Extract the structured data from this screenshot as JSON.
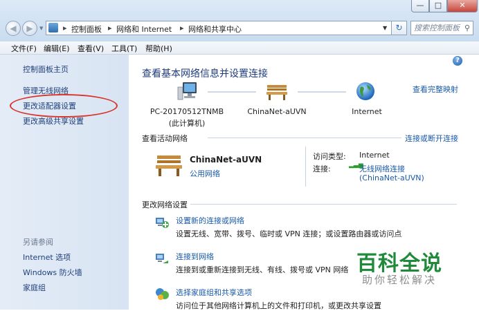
{
  "window": {
    "min_label": "—",
    "max_label": "□",
    "close_label": "✕"
  },
  "address": {
    "crumbs": [
      "控制面板",
      "网络和 Internet",
      "网络和共享中心"
    ],
    "search_placeholder": "搜索控制面板"
  },
  "menu": [
    "文件(F)",
    "编辑(E)",
    "查看(V)",
    "工具(T)",
    "帮助(H)"
  ],
  "left": {
    "home": "控制面板主页",
    "links": [
      "管理无线网络",
      "更改适配器设置",
      "更改高级共享设置"
    ],
    "see_also_title": "另请参阅",
    "see_also": [
      "Internet 选项",
      "Windows 防火墙",
      "家庭组"
    ]
  },
  "main": {
    "title": "查看基本网络信息并设置连接",
    "view_full_map": "查看完整映射",
    "nodes": [
      {
        "name": "PC-20170512TNMB",
        "sub": "(此计算机)",
        "icon": "computer-icon"
      },
      {
        "name": "ChinaNet-aUVN",
        "icon": "bench-icon"
      },
      {
        "name": "Internet",
        "icon": "globe-icon"
      }
    ],
    "active_title": "查看活动网络",
    "connect_disconnect": "连接或断开连接",
    "active": {
      "network_name": "ChinaNet-aUVN",
      "network_type": "公用网络",
      "access_label": "访问类型:",
      "access_value": "Internet",
      "conn_label": "连接:",
      "conn_value": "无线网络连接",
      "conn_value2": "(ChinaNet-aUVN)"
    },
    "change_title": "更改网络设置",
    "tasks": [
      {
        "title": "设置新的连接或网络",
        "desc": "设置无线、宽带、拨号、临时或 VPN 连接；或设置路由器或访问点"
      },
      {
        "title": "连接到网络",
        "desc": "连接到或重新连接到无线、有线、拨号或 VPN 网络"
      },
      {
        "title": "选择家庭组和共享选项",
        "desc": "访问位于其他网络计算机上的文件和打印机，或更改共享设置"
      }
    ]
  },
  "watermark": {
    "brand": "百科全说",
    "slogan": "助你轻松解决"
  },
  "colors": {
    "link": "#1a5aa8",
    "title": "#1e3a7b",
    "highlight_ellipse": "#d8352c",
    "watermark": "#1f8a3a"
  }
}
